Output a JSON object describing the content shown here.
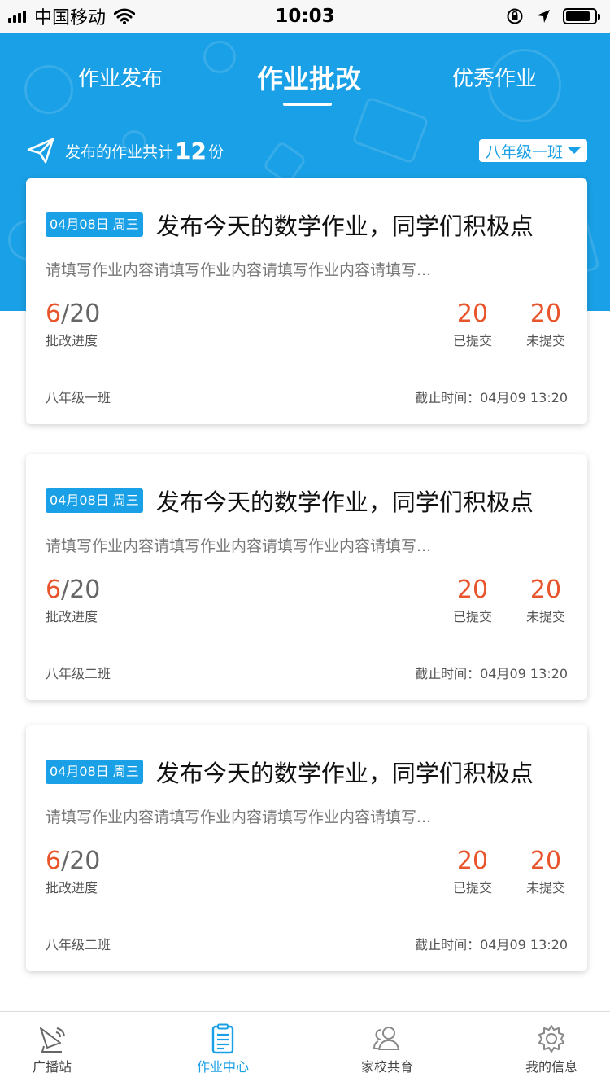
{
  "status_bar": {
    "carrier": "中国移动",
    "time": "10:03",
    "battery_level": 0.85
  },
  "header": {
    "tabs": [
      {
        "label": "作业发布",
        "active": false
      },
      {
        "label": "作业批改",
        "active": true
      },
      {
        "label": "优秀作业",
        "active": false
      }
    ],
    "summary_prefix": "发布的作业共计",
    "summary_count": "12",
    "summary_suffix": "份",
    "class_selector": "八年级一班"
  },
  "cards": [
    {
      "date_badge": "04月08日 周三",
      "title": "发布今天的数学作业，同学们积极点",
      "description": "请填写作业内容请填写作业内容请填写作业内容请填写...",
      "progress_done": "6",
      "progress_total": "/20",
      "progress_label": "批改进度",
      "submitted_count": "20",
      "submitted_label": "已提交",
      "unsubmitted_count": "20",
      "unsubmitted_label": "未提交",
      "class_name": "八年级一班",
      "deadline": "截止时间：04月09 13:20"
    },
    {
      "date_badge": "04月08日 周三",
      "title": "发布今天的数学作业，同学们积极点",
      "description": "请填写作业内容请填写作业内容请填写作业内容请填写...",
      "progress_done": "6",
      "progress_total": "/20",
      "progress_label": "批改进度",
      "submitted_count": "20",
      "submitted_label": "已提交",
      "unsubmitted_count": "20",
      "unsubmitted_label": "未提交",
      "class_name": "八年级二班",
      "deadline": "截止时间：04月09 13:20"
    },
    {
      "date_badge": "04月08日 周三",
      "title": "发布今天的数学作业，同学们积极点",
      "description": "请填写作业内容请填写作业内容请填写作业内容请填写...",
      "progress_done": "6",
      "progress_total": "/20",
      "progress_label": "批改进度",
      "submitted_count": "20",
      "submitted_label": "已提交",
      "unsubmitted_count": "20",
      "unsubmitted_label": "未提交",
      "class_name": "八年级二班",
      "deadline": "截止时间：04月09 13:20"
    }
  ],
  "tabbar": {
    "items": [
      {
        "label": "广播站",
        "icon": "broadcast-icon",
        "active": false
      },
      {
        "label": "作业中心",
        "icon": "clipboard-icon",
        "active": true
      },
      {
        "label": "家校共育",
        "icon": "people-icon",
        "active": false
      },
      {
        "label": "我的信息",
        "icon": "gear-icon",
        "active": false
      }
    ]
  },
  "colors": {
    "primary": "#1aa0e6",
    "accent": "#e8542c"
  }
}
